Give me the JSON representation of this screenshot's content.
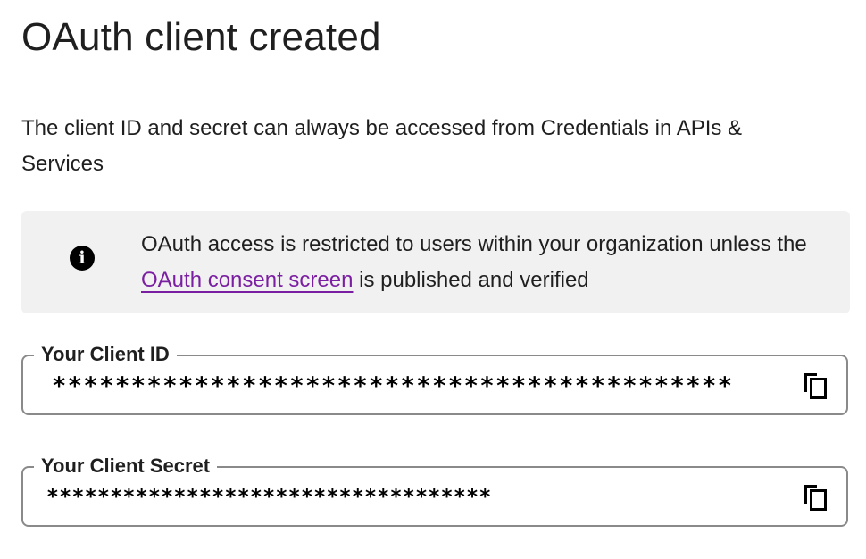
{
  "dialog": {
    "title": "OAuth client created",
    "description": "The client ID and secret can always be accessed from Credentials in APIs & Services"
  },
  "info_banner": {
    "icon": "info-icon",
    "text_before": "OAuth access is restricted to users within your organization unless the ",
    "link_text": "OAuth consent screen",
    "text_after": " is published and verified"
  },
  "client_id": {
    "label": "Your Client ID",
    "value": "*******************************************",
    "copy_icon": "copy-icon"
  },
  "client_secret": {
    "label": "Your Client Secret",
    "value": "***********************************",
    "copy_icon": "copy-icon"
  },
  "colors": {
    "link": "#7b1fa2",
    "banner_background": "#f1f1f1",
    "field_border": "#8a8a8a",
    "text": "#1f1f1f"
  }
}
